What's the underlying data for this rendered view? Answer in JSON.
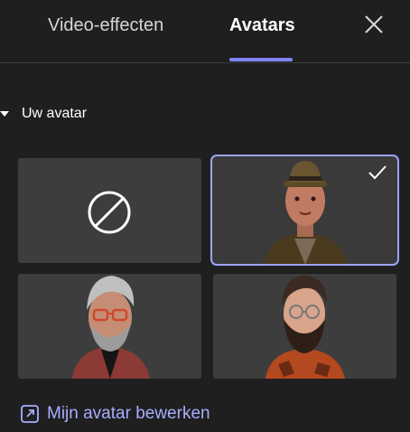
{
  "header": {
    "tabs": [
      {
        "label": "Video-effecten",
        "active": false
      },
      {
        "label": "Avatars",
        "active": true
      }
    ],
    "close_icon": "close-icon",
    "accent_color": "#7f85f5"
  },
  "section": {
    "label": "Uw avatar",
    "expanded": true
  },
  "avatars": [
    {
      "name": "none",
      "icon": "no-avatar-icon",
      "selected": false
    },
    {
      "name": "avatar-hat",
      "selected": true
    },
    {
      "name": "avatar-gray-beard",
      "selected": false
    },
    {
      "name": "avatar-dark-beard",
      "selected": false
    }
  ],
  "footer": {
    "edit_label": "Mijn avatar bewerken",
    "edit_icon": "open-external-icon"
  }
}
